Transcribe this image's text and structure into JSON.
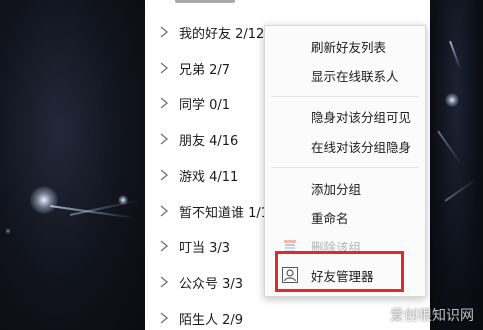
{
  "contact_groups": [
    {
      "label": "我的好友 2/12"
    },
    {
      "label": "兄弟 2/7"
    },
    {
      "label": "同学 0/1"
    },
    {
      "label": "朋友 4/16"
    },
    {
      "label": "游戏 4/11"
    },
    {
      "label": "暂不知道谁 1/1"
    },
    {
      "label": "叮当 3/3"
    },
    {
      "label": "公众号 3/3"
    },
    {
      "label": "陌生人 2/9"
    }
  ],
  "context_menu": {
    "items": [
      {
        "label": "刷新好友列表",
        "enabled": true
      },
      {
        "label": "显示在线联系人",
        "enabled": true
      },
      {
        "label": "隐身对该分组可见",
        "enabled": true
      },
      {
        "label": "在线对该分组隐身",
        "enabled": true
      },
      {
        "label": "添加分组",
        "enabled": true
      },
      {
        "label": "重命名",
        "enabled": true
      },
      {
        "label": "删除该组",
        "enabled": false
      },
      {
        "label": "好友管理器",
        "enabled": true
      }
    ]
  },
  "highlight": {
    "target": "好友管理器",
    "color": "#e2282d"
  },
  "watermark": {
    "text": "爱创根知识网"
  },
  "colors": {
    "menu_bg": "#fbfbfb",
    "list_bg": "#ffffff",
    "disabled_text": "#b3b3b3",
    "highlight": "#e2282d"
  }
}
